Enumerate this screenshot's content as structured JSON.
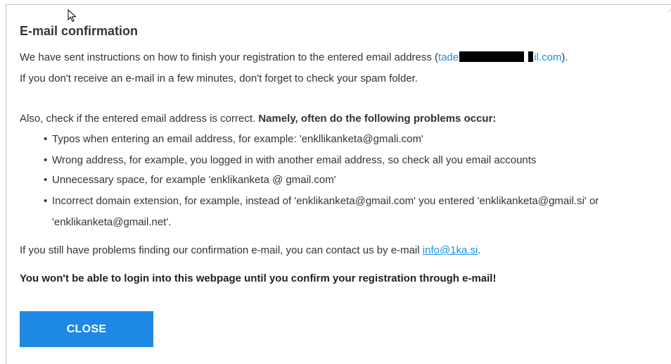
{
  "dialog": {
    "title": "E-mail confirmation",
    "sent_prefix": "We have sent instructions on how to finish your registration to the entered email address (",
    "email_visible_start": "tade",
    "email_visible_end": "il.com",
    "sent_suffix": ").",
    "spam_line": "If you don't receive an e-mail in a few minutes, don't forget to check your spam folder.",
    "check_prefix": "Also, check if the entered email address is correct. ",
    "check_bold": "Namely, often do the following problems occur:",
    "problems": [
      "Typos when entering an email address, for example: 'enkllikanketa@gmali.com'",
      "Wrong address, for example, you logged in with another email address, so check all you email accounts",
      "Unnecessary space, for example 'enklikanketa @ gmail.com'",
      "Incorrect domain extension, for example, instead of 'enklikanketa@gmail.com' you entered 'enklikanketa@gmail.si' or",
      "'enklikanketa@gmail.net'."
    ],
    "contact_prefix": "If you still have problems finding our confirmation e-mail, you can contact us by e-mail ",
    "contact_link": "info@1ka.si",
    "contact_suffix": ".",
    "warning": "You won't be able to login into this webpage until you confirm your registration through e-mail!",
    "close_label": "CLOSE"
  },
  "colors": {
    "accent": "#1e88e5",
    "link": "#1a8fe3",
    "text": "#333333"
  },
  "icons": {
    "cursor": "mouse-pointer-icon",
    "corner": "close-x-icon"
  }
}
